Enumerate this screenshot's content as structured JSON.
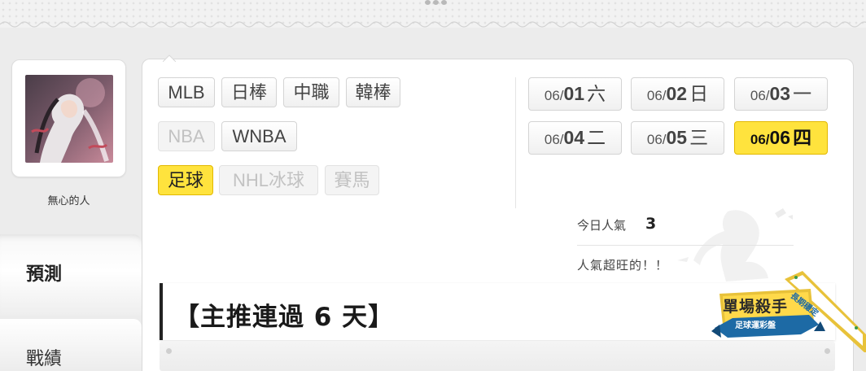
{
  "profile": {
    "username": "無心的人"
  },
  "nav": {
    "predict_label": "預測",
    "record_label": "戰績"
  },
  "leagues": [
    {
      "label": "MLB",
      "state": "normal"
    },
    {
      "label": "日棒",
      "state": "normal"
    },
    {
      "label": "中職",
      "state": "normal"
    },
    {
      "label": "韓棒",
      "state": "normal"
    },
    {
      "label": "NBA",
      "state": "disabled"
    },
    {
      "label": "WNBA",
      "state": "normal"
    },
    {
      "label": "足球",
      "state": "active"
    },
    {
      "label": "NHL冰球",
      "state": "disabled"
    },
    {
      "label": "賽馬",
      "state": "disabled"
    }
  ],
  "dates": [
    {
      "month": "06/",
      "day": "01",
      "weekday": "六",
      "state": "normal"
    },
    {
      "month": "06/",
      "day": "02",
      "weekday": "日",
      "state": "normal"
    },
    {
      "month": "06/",
      "day": "03",
      "weekday": "一",
      "state": "normal"
    },
    {
      "month": "06/",
      "day": "04",
      "weekday": "二",
      "state": "normal"
    },
    {
      "month": "06/",
      "day": "05",
      "weekday": "三",
      "state": "normal"
    },
    {
      "month": "06/",
      "day": "06",
      "weekday": "四",
      "state": "active"
    }
  ],
  "popularity": {
    "label": "今日人氣",
    "value": "3",
    "note": "人氣超旺的！！"
  },
  "post": {
    "headline": "【主推連過 6 天】"
  },
  "badge": {
    "title": "單場殺手",
    "subtitle": "足球運彩盤",
    "ribbon": "長期穩定"
  },
  "colors": {
    "active": "#ffe33d",
    "badge_blue": "#1d6aa5",
    "badge_gold": "#e8c23a"
  }
}
